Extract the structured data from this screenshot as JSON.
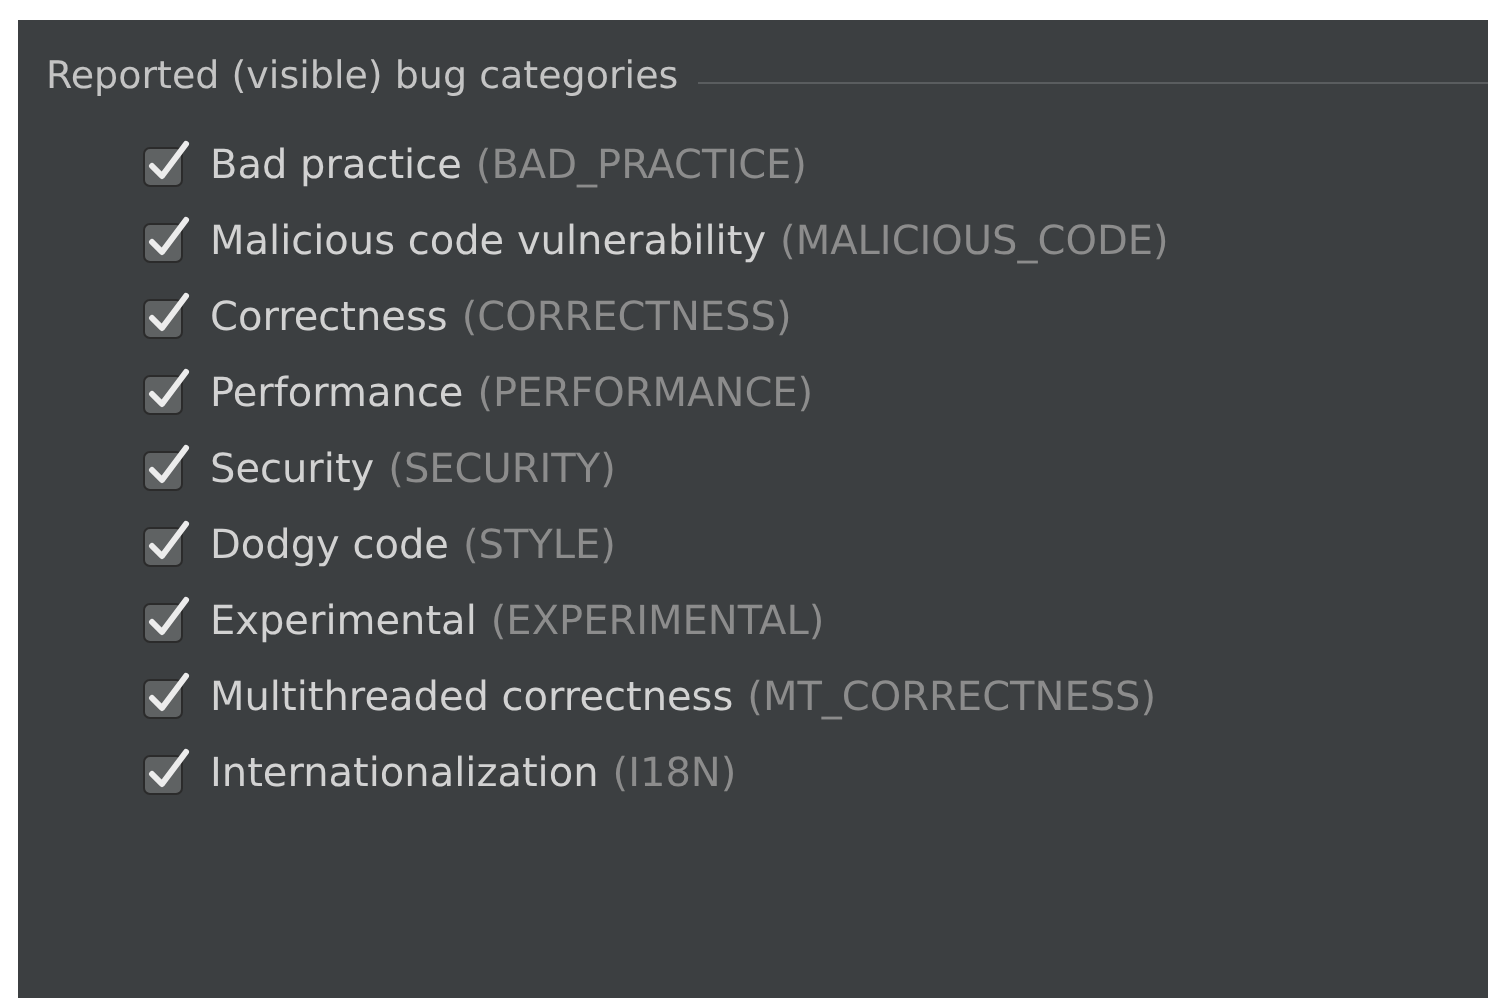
{
  "group": {
    "title": "Reported (visible) bug categories"
  },
  "categories": [
    {
      "label": "Bad practice",
      "code": "(BAD_PRACTICE)",
      "checked": true
    },
    {
      "label": "Malicious code vulnerability",
      "code": "(MALICIOUS_CODE)",
      "checked": true
    },
    {
      "label": "Correctness",
      "code": "(CORRECTNESS)",
      "checked": true
    },
    {
      "label": "Performance",
      "code": "(PERFORMANCE)",
      "checked": true
    },
    {
      "label": "Security",
      "code": "(SECURITY)",
      "checked": true
    },
    {
      "label": "Dodgy code",
      "code": "(STYLE)",
      "checked": true
    },
    {
      "label": "Experimental",
      "code": "(EXPERIMENTAL)",
      "checked": true
    },
    {
      "label": "Multithreaded correctness",
      "code": "(MT_CORRECTNESS)",
      "checked": true
    },
    {
      "label": "Internationalization",
      "code": "(I18N)",
      "checked": true
    }
  ]
}
